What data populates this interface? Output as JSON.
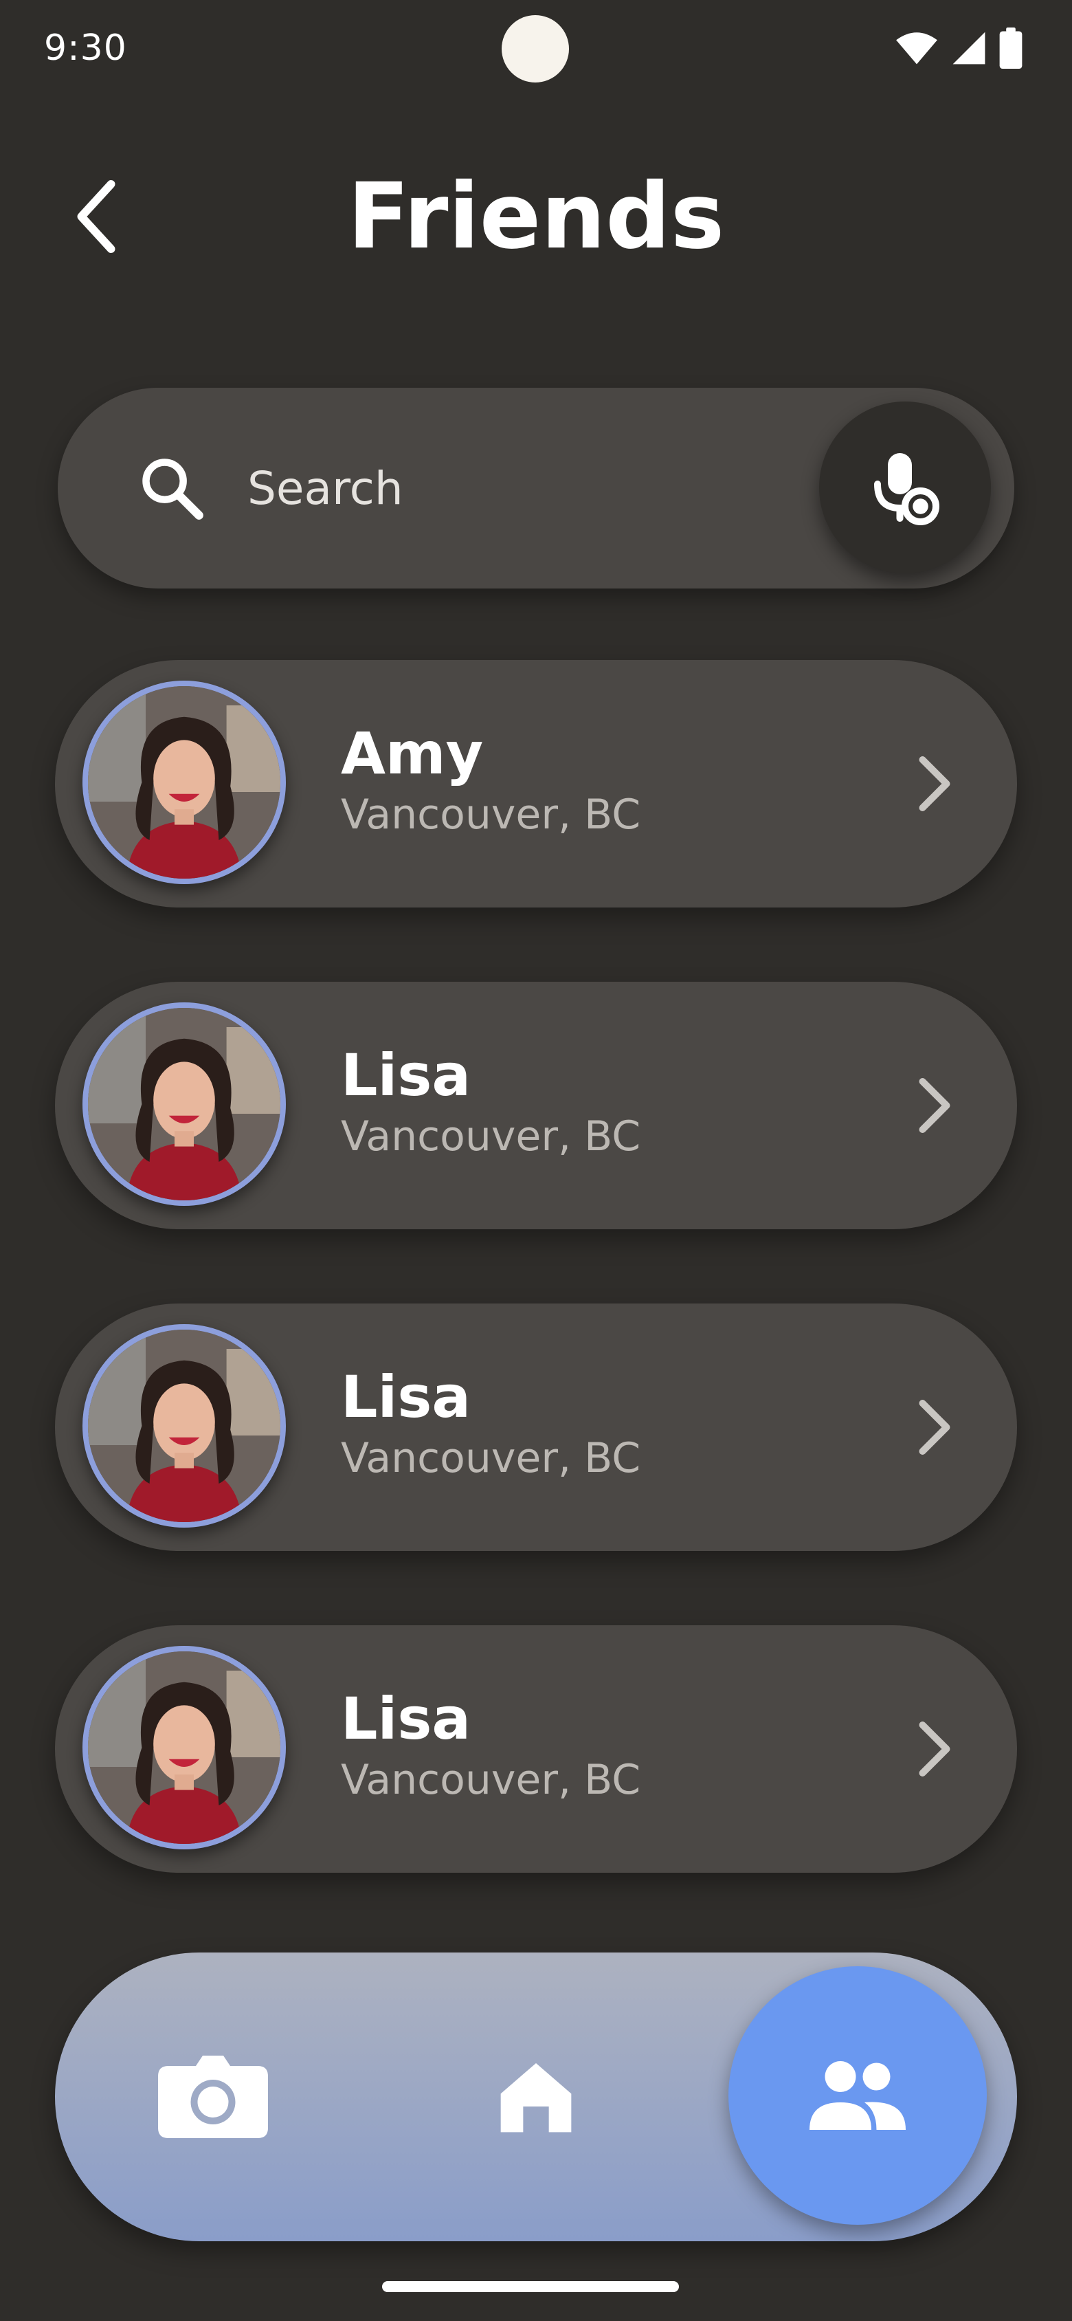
{
  "status_bar": {
    "time": "9:30"
  },
  "header": {
    "title": "Friends",
    "back_icon": "chevron-left-icon"
  },
  "search": {
    "placeholder": "Search",
    "value": "",
    "search_icon": "search-icon",
    "voice_icon": "voice-search-icon"
  },
  "friends": [
    {
      "name": "Amy",
      "location": "Vancouver, BC"
    },
    {
      "name": "Lisa",
      "location": "Vancouver, BC"
    },
    {
      "name": "Lisa",
      "location": "Vancouver, BC"
    },
    {
      "name": "Lisa",
      "location": "Vancouver, BC"
    }
  ],
  "bottom_nav": {
    "items": [
      {
        "icon": "camera-icon",
        "active": false
      },
      {
        "icon": "home-icon",
        "active": false
      },
      {
        "icon": "friends-icon",
        "active": true
      }
    ]
  },
  "colors": {
    "background": "#2f2d2a",
    "card": "#4b4845",
    "avatar_ring": "#8d9fdc",
    "accent": "#6a98f0"
  }
}
